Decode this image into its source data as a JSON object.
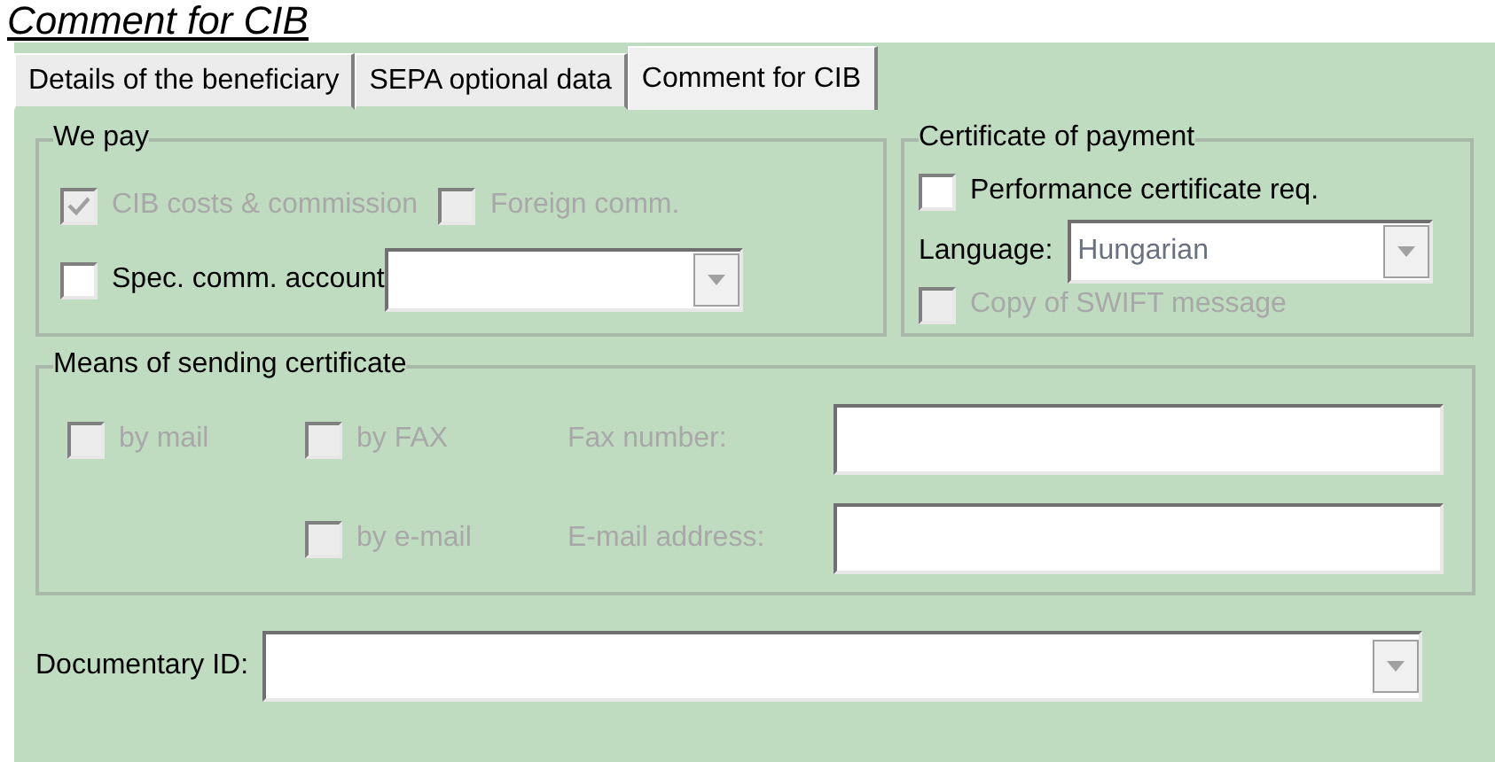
{
  "heading": "Comment for CIB",
  "tabs": [
    {
      "label": "Details of the beneficiary",
      "selected": false
    },
    {
      "label": "SEPA optional data",
      "selected": false
    },
    {
      "label": "Comment for CIB",
      "selected": true
    }
  ],
  "we_pay": {
    "title": "We pay",
    "options": [
      {
        "label": "CIB costs & commission",
        "checked": true,
        "disabled": true
      },
      {
        "label": "Foreign comm.",
        "checked": false,
        "disabled": true
      }
    ],
    "spec_account": {
      "label": "Spec. comm. account",
      "checked": false,
      "disabled": false
    }
  },
  "certificate_of_payment": {
    "title": "Certificate of payment",
    "performance": {
      "label": "Performance certificate req.",
      "checked": false,
      "disabled": false
    },
    "language": {
      "label": "Language:",
      "value": "Hungarian"
    },
    "swift_copy": {
      "label": "Copy of SWIFT message",
      "checked": false,
      "disabled": true
    }
  },
  "means_of_sending": {
    "title": "Means of sending certificate",
    "by_mail": {
      "label": "by mail",
      "checked": false,
      "disabled": true
    },
    "by_fax": {
      "label": "by FAX",
      "checked": false,
      "disabled": true
    },
    "by_email": {
      "label": "by e-mail",
      "checked": false,
      "disabled": true
    },
    "fax_number": {
      "label": "Fax number:",
      "disabled": true
    },
    "email_address": {
      "label": "E-mail address:",
      "disabled": true
    }
  },
  "documentary_id": {
    "label": "Documentary ID:"
  }
}
